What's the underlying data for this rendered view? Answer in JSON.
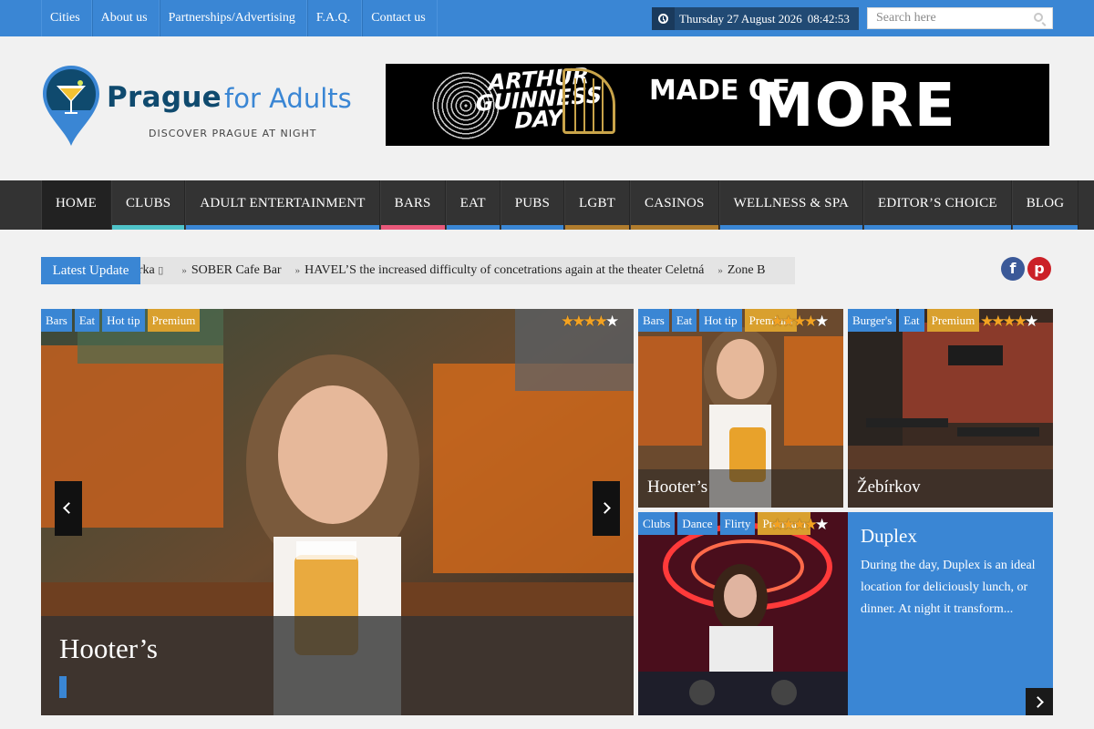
{
  "topbar": {
    "links": [
      "Cities",
      "About us",
      "Partnerships/Advertising",
      "F.A.Q.",
      "Contact us"
    ],
    "date": "Thursday 27 August 2026",
    "time": "08:42:53",
    "search_placeholder": "Search here"
  },
  "logo": {
    "word1": "Prague",
    "word2": "for Adults",
    "tagline": "DISCOVER PRAGUE AT NIGHT"
  },
  "banner": {
    "line1": "ARTHUR GUINNESS DAY",
    "made": "MADE OF",
    "more": "MORE"
  },
  "nav": {
    "items": [
      {
        "label": "HOME",
        "color": "#222222"
      },
      {
        "label": "CLUBS",
        "color": "#4fc3c9"
      },
      {
        "label": "ADULT ENTERTAINMENT",
        "color": "#3a86d4"
      },
      {
        "label": "BARS",
        "color": "#e8587a"
      },
      {
        "label": "EAT",
        "color": "#3a86d4"
      },
      {
        "label": "PUBS",
        "color": "#3a86d4"
      },
      {
        "label": "LGBT",
        "color": "#b07c2d"
      },
      {
        "label": "CASINOS",
        "color": "#b07c2d"
      },
      {
        "label": "WELLNESS & SPA",
        "color": "#3a86d4"
      },
      {
        "label": "EDITOR’S CHOICE",
        "color": "#3a86d4"
      },
      {
        "label": "BLOG",
        "color": "#3a86d4"
      }
    ]
  },
  "ticker": {
    "label": "Latest Update",
    "items": [
      "irka",
      "SOBER Cafe Bar",
      "HAVEL’S the increased difficulty of concetrations again at the theater Celetná",
      "Zone B"
    ]
  },
  "social": {
    "facebook": "f",
    "pinterest": "p"
  },
  "colors": {
    "accent": "#3a86d4",
    "premium": "#d9a02e",
    "stars": "#f3a221"
  },
  "slider": {
    "main": {
      "title": "Hooter’s",
      "tags": [
        "Bars",
        "Eat",
        "Hot tip",
        "Premium"
      ],
      "rating": 4.5
    },
    "tiles": [
      {
        "title": "Hooter’s",
        "tags": [
          "Bars",
          "Eat",
          "Hot tip",
          "Premium"
        ],
        "rating": 4.5
      },
      {
        "title": "Žebírkov",
        "tags": [
          "Burger's",
          "Eat",
          "Premium"
        ],
        "rating": 4.5
      },
      {
        "title": "Duplex",
        "tags": [
          "Clubs",
          "Dance",
          "Flirty",
          "Premium"
        ],
        "rating": 4.5,
        "excerpt": "During the day, Duplex is an ideal location for deliciously lunch, or dinner. At night it transform..."
      }
    ]
  }
}
